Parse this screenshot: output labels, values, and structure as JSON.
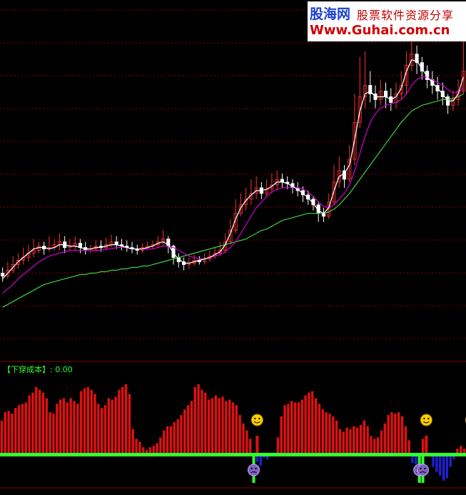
{
  "watermark": {
    "site_name": "股海网",
    "slogan": "股票软件资源分享",
    "url": "Www.Guhai.com.cn"
  },
  "indicator": {
    "name": "【下穿成本】",
    "value_text": ": 0.00"
  },
  "colors": {
    "background": "#000000",
    "grid": "#8a0000",
    "candle_up": "#ff3030",
    "candle_down": "#ffffff",
    "ma_short": "#ffffff",
    "ma_mid": "#d000d0",
    "ma_long": "#40d040",
    "bar_positive": "#e01010",
    "bar_negative": "#2020d0",
    "zero_line": "#30ff30",
    "smiley": "#ffd000"
  },
  "icons": {
    "smiley": "smiley-face-icon",
    "sad": "sad-face-icon"
  },
  "chart_data": {
    "type": "candlestick+histogram",
    "price_panel": {
      "candles": [
        [
          44,
          42,
          48,
          38
        ],
        [
          42,
          46,
          52,
          40
        ],
        [
          46,
          50,
          56,
          44
        ],
        [
          50,
          53,
          58,
          47
        ],
        [
          53,
          55,
          62,
          50
        ],
        [
          55,
          58,
          64,
          52
        ],
        [
          58,
          60,
          68,
          55
        ],
        [
          60,
          63,
          66,
          58
        ],
        [
          63,
          61,
          66,
          57
        ],
        [
          61,
          62,
          70,
          59
        ],
        [
          62,
          64,
          68,
          60
        ],
        [
          64,
          66,
          72,
          60
        ],
        [
          66,
          62,
          70,
          58
        ],
        [
          62,
          63,
          68,
          60
        ],
        [
          63,
          65,
          70,
          60
        ],
        [
          65,
          62,
          68,
          58
        ],
        [
          62,
          60,
          66,
          57
        ],
        [
          60,
          61,
          64,
          58
        ],
        [
          61,
          63,
          67,
          59
        ],
        [
          63,
          62,
          67,
          59
        ],
        [
          62,
          64,
          69,
          60
        ],
        [
          64,
          66,
          71,
          62
        ],
        [
          66,
          64,
          70,
          61
        ],
        [
          64,
          63,
          68,
          60
        ],
        [
          63,
          62,
          67,
          59
        ],
        [
          62,
          61,
          66,
          58
        ],
        [
          61,
          60,
          64,
          57
        ],
        [
          60,
          62,
          65,
          58
        ],
        [
          62,
          63,
          66,
          60
        ],
        [
          63,
          64,
          67,
          61
        ],
        [
          64,
          66,
          70,
          62
        ],
        [
          66,
          68,
          74,
          63
        ],
        [
          68,
          63,
          70,
          58
        ],
        [
          63,
          55,
          64,
          50
        ],
        [
          55,
          52,
          58,
          48
        ],
        [
          52,
          50,
          55,
          46
        ],
        [
          50,
          51,
          55,
          47
        ],
        [
          51,
          53,
          57,
          49
        ],
        [
          53,
          52,
          56,
          50
        ],
        [
          52,
          54,
          58,
          50
        ],
        [
          54,
          56,
          60,
          52
        ],
        [
          56,
          58,
          62,
          54
        ],
        [
          58,
          60,
          66,
          56
        ],
        [
          60,
          66,
          72,
          58
        ],
        [
          66,
          74,
          82,
          64
        ],
        [
          74,
          86,
          96,
          72
        ],
        [
          86,
          92,
          100,
          84
        ],
        [
          92,
          96,
          104,
          88
        ],
        [
          96,
          100,
          110,
          92
        ],
        [
          100,
          104,
          112,
          96
        ],
        [
          104,
          100,
          108,
          96
        ],
        [
          100,
          103,
          110,
          98
        ],
        [
          103,
          106,
          114,
          100
        ],
        [
          106,
          110,
          116,
          102
        ],
        [
          110,
          108,
          114,
          104
        ],
        [
          108,
          107,
          112,
          103
        ],
        [
          107,
          104,
          110,
          100
        ],
        [
          104,
          102,
          108,
          98
        ],
        [
          102,
          99,
          105,
          94
        ],
        [
          99,
          96,
          102,
          92
        ],
        [
          96,
          92,
          98,
          88
        ],
        [
          92,
          86,
          94,
          80
        ],
        [
          86,
          84,
          90,
          80
        ],
        [
          84,
          94,
          100,
          82
        ],
        [
          94,
          108,
          120,
          92
        ],
        [
          108,
          116,
          126,
          104
        ],
        [
          116,
          110,
          120,
          104
        ],
        [
          110,
          124,
          134,
          108
        ],
        [
          124,
          150,
          170,
          120
        ],
        [
          150,
          168,
          196,
          146
        ],
        [
          168,
          176,
          200,
          160
        ],
        [
          176,
          170,
          186,
          164
        ],
        [
          170,
          166,
          176,
          160
        ],
        [
          166,
          172,
          180,
          162
        ],
        [
          172,
          168,
          178,
          160
        ],
        [
          168,
          164,
          174,
          158
        ],
        [
          164,
          170,
          178,
          160
        ],
        [
          170,
          176,
          186,
          166
        ],
        [
          176,
          190,
          200,
          170
        ],
        [
          190,
          198,
          212,
          186
        ],
        [
          198,
          192,
          204,
          184
        ],
        [
          192,
          186,
          196,
          180
        ],
        [
          186,
          180,
          190,
          174
        ],
        [
          180,
          176,
          186,
          170
        ],
        [
          176,
          172,
          182,
          166
        ],
        [
          172,
          168,
          178,
          162
        ],
        [
          168,
          162,
          170,
          156
        ],
        [
          162,
          166,
          172,
          158
        ],
        [
          166,
          172,
          180,
          162
        ],
        [
          172,
          186,
          214,
          170
        ]
      ],
      "ma_short": [
        40,
        44,
        48,
        52,
        55,
        58,
        61,
        62,
        62,
        61,
        62,
        64,
        64,
        63,
        63,
        62,
        61,
        61,
        62,
        62,
        63,
        64,
        64,
        63,
        62,
        61,
        61,
        61,
        62,
        63,
        65,
        66,
        64,
        58,
        54,
        51,
        51,
        52,
        53,
        54,
        55,
        57,
        59,
        64,
        72,
        82,
        90,
        95,
        99,
        102,
        102,
        103,
        105,
        108,
        108,
        107,
        105,
        103,
        100,
        97,
        93,
        88,
        86,
        90,
        102,
        112,
        114,
        120,
        138,
        158,
        170,
        172,
        168,
        168,
        168,
        166,
        168,
        174,
        186,
        194,
        193,
        188,
        182,
        178,
        174,
        170,
        165,
        165,
        170,
        182
      ],
      "ma_mid": [
        30,
        33,
        36,
        40,
        43,
        46,
        49,
        52,
        54,
        56,
        57,
        58,
        59,
        60,
        60,
        60,
        60,
        60,
        60,
        60,
        61,
        61,
        62,
        62,
        62,
        61,
        61,
        61,
        61,
        61,
        62,
        63,
        63,
        62,
        60,
        58,
        56,
        55,
        54,
        54,
        55,
        56,
        57,
        59,
        62,
        66,
        72,
        78,
        84,
        90,
        94,
        98,
        101,
        103,
        104,
        104,
        104,
        104,
        103,
        101,
        98,
        94,
        91,
        90,
        92,
        96,
        100,
        106,
        116,
        128,
        140,
        150,
        156,
        160,
        162,
        163,
        164,
        166,
        170,
        176,
        180,
        182,
        182,
        180,
        178,
        176,
        173,
        171,
        171,
        174
      ],
      "ma_long": [
        20,
        22,
        24,
        26,
        28,
        30,
        32,
        34,
        36,
        37,
        38,
        39,
        40,
        41,
        42,
        43,
        43,
        44,
        44,
        45,
        45,
        46,
        46,
        47,
        47,
        48,
        48,
        49,
        49,
        50,
        51,
        52,
        53,
        54,
        55,
        56,
        57,
        58,
        59,
        60,
        61,
        62,
        63,
        64,
        65,
        66,
        67,
        68,
        70,
        72,
        74,
        75,
        77,
        79,
        81,
        82,
        83,
        84,
        85,
        86,
        86,
        86,
        86,
        87,
        89,
        92,
        96,
        100,
        105,
        110,
        115,
        120,
        125,
        130,
        135,
        140,
        145,
        150,
        154,
        158,
        160,
        162,
        163,
        164,
        165,
        166,
        166,
        167,
        168,
        170
      ],
      "ylim": [
        0,
        230
      ]
    },
    "indicator_panel": {
      "name": "下穿成本",
      "current_value": 0.0,
      "values": [
        48,
        60,
        62,
        58,
        66,
        70,
        72,
        74,
        84,
        88,
        96,
        92,
        88,
        80,
        60,
        58,
        72,
        78,
        80,
        74,
        80,
        76,
        72,
        90,
        94,
        96,
        92,
        86,
        72,
        66,
        70,
        80,
        78,
        82,
        92,
        96,
        100,
        86,
        36,
        22,
        18,
        10,
        6,
        10,
        12,
        16,
        24,
        34,
        40,
        40,
        46,
        50,
        56,
        64,
        70,
        76,
        96,
        100,
        92,
        88,
        78,
        80,
        84,
        80,
        82,
        76,
        78,
        74,
        70,
        56,
        44,
        34,
        22,
        0,
        -12,
        -18,
        -6,
        -8,
        0,
        0,
        24,
        54,
        70,
        72,
        76,
        74,
        74,
        78,
        84,
        88,
        90,
        80,
        72,
        64,
        60,
        58,
        54,
        48,
        36,
        32,
        38,
        36,
        40,
        38,
        42,
        48,
        40,
        26,
        22,
        24,
        34,
        44,
        56,
        60,
        58,
        60,
        54,
        40,
        20,
        -14,
        -16,
        0,
        22,
        0,
        -4,
        -20,
        -28,
        -34,
        -42,
        -38,
        -20,
        -8,
        8,
        12,
        8
      ],
      "signals": [
        {
          "index": 73,
          "type": "sad"
        },
        {
          "index": 74,
          "type": "smile"
        },
        {
          "index": 121,
          "type": "sad"
        },
        {
          "index": 122,
          "type": "sad"
        },
        {
          "index": 123,
          "type": "smile"
        },
        {
          "index": 136,
          "type": "smile"
        }
      ],
      "ylim": [
        -50,
        110
      ]
    }
  }
}
